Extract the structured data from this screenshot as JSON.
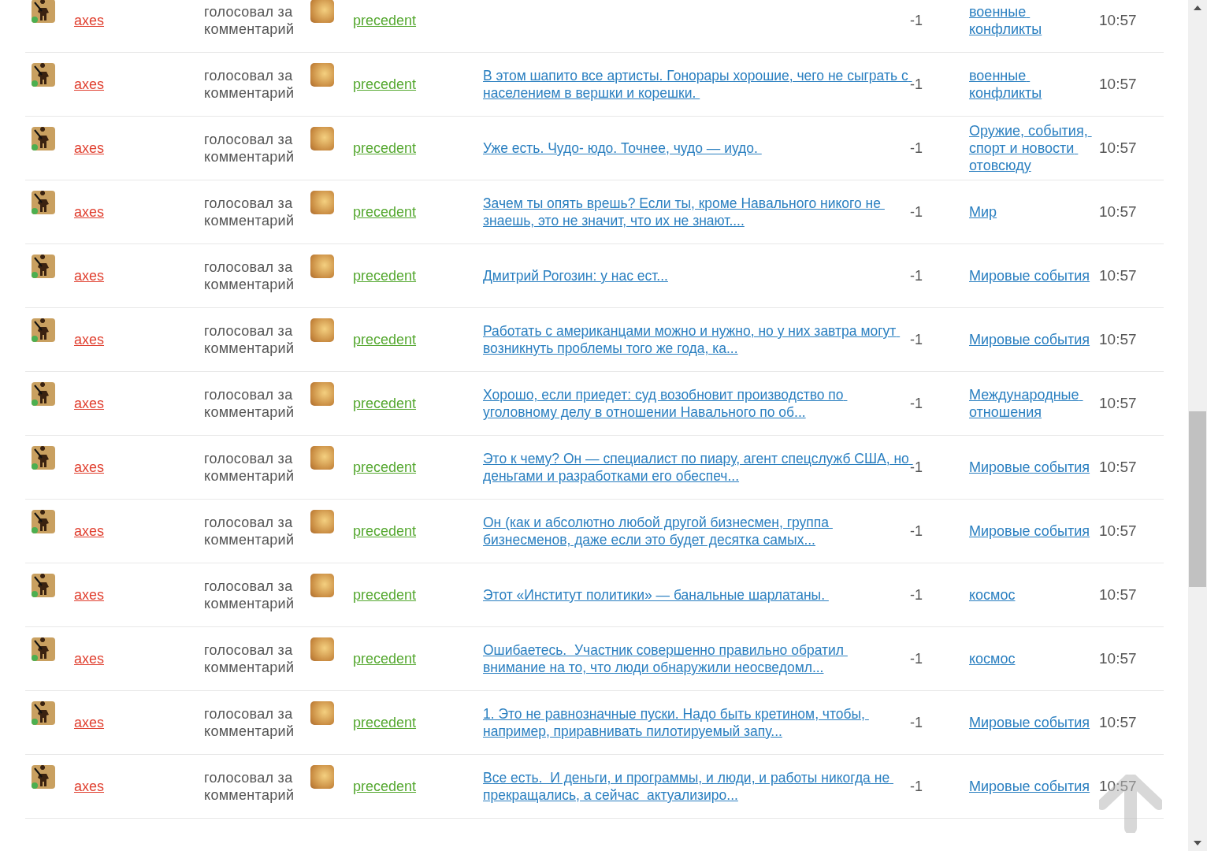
{
  "rows": [
    {
      "user": "axes",
      "action": "голосовал за комментарий",
      "voter": "precedent",
      "comment": "",
      "score": "-1",
      "category": "военные конфликты",
      "time": "10:57"
    },
    {
      "user": "axes",
      "action": "голосовал за комментарий",
      "voter": "precedent",
      "comment": "В этом шапито все артисты. Гонорары хорошие, чего не сыграть с населением в вершки и корешки. ",
      "score": "-1",
      "category": "военные конфликты",
      "time": "10:57"
    },
    {
      "user": "axes",
      "action": "голосовал за комментарий",
      "voter": "precedent",
      "comment": "Уже есть. Чудо- юдо. Точнее, чудо — иудо. ",
      "score": "-1",
      "category": "Оружие, события, спорт и новости отовсюду",
      "time": "10:57"
    },
    {
      "user": "axes",
      "action": "голосовал за комментарий",
      "voter": "precedent",
      "comment": "Зачем ты опять врешь? Если ты, кроме Навального никого не знаешь, это не значит, что их не знают....",
      "score": "-1",
      "category": "Мир",
      "time": "10:57"
    },
    {
      "user": "axes",
      "action": "голосовал за комментарий",
      "voter": "precedent",
      "comment": "Дмитрий Рогозин: у нас ест...",
      "score": "-1",
      "category": "Мировые события",
      "time": "10:57"
    },
    {
      "user": "axes",
      "action": "голосовал за комментарий",
      "voter": "precedent",
      "comment": "Работать с американцами можно и нужно, но у них завтра могут возникнуть проблемы того же года, ка...",
      "score": "-1",
      "category": "Мировые события",
      "time": "10:57"
    },
    {
      "user": "axes",
      "action": "голосовал за комментарий",
      "voter": "precedent",
      "comment": "Хорошо, если приедет: суд возобновит производство по уголовному делу в отношении Навального по об...",
      "score": "-1",
      "category": "Международные отношения",
      "time": "10:57"
    },
    {
      "user": "axes",
      "action": "голосовал за комментарий",
      "voter": "precedent",
      "comment": "Это к чему? Он — специалист по пиару, агент спецслужб США, но деньгами и разработками его обеспеч...",
      "score": "-1",
      "category": "Мировые события",
      "time": "10:57"
    },
    {
      "user": "axes",
      "action": "голосовал за комментарий",
      "voter": "precedent",
      "comment": "Он (как и абсолютно любой другой бизнесмен, группа бизнесменов, даже если это будет десятка самых...",
      "score": "-1",
      "category": "Мировые события",
      "time": "10:57"
    },
    {
      "user": "axes",
      "action": "голосовал за комментарий",
      "voter": "precedent",
      "comment": "Этот «Институт политики» — банальные шарлатаны. ",
      "score": "-1",
      "category": "космос",
      "time": "10:57"
    },
    {
      "user": "axes",
      "action": "голосовал за комментарий",
      "voter": "precedent",
      "comment": "Ошибаетесь.  Участник совершенно правильно обратил внимание на то, что люди обнаружили неосведомл...",
      "score": "-1",
      "category": "космос",
      "time": "10:57"
    },
    {
      "user": "axes",
      "action": "голосовал за комментарий",
      "voter": "precedent",
      "comment": "1. Это не равнозначные пуски. Надо быть кретином, чтобы, например, приравнивать пилотируемый запу...",
      "score": "-1",
      "category": "Мировые события",
      "time": "10:57"
    },
    {
      "user": "axes",
      "action": "голосовал за комментарий",
      "voter": "precedent",
      "comment": "Все есть.  И деньги, и программы, и люди, и работы никогда не прекращались, а сейчас  актуализиро...",
      "score": "-1",
      "category": "Мировые события",
      "time": "10:57"
    }
  ]
}
